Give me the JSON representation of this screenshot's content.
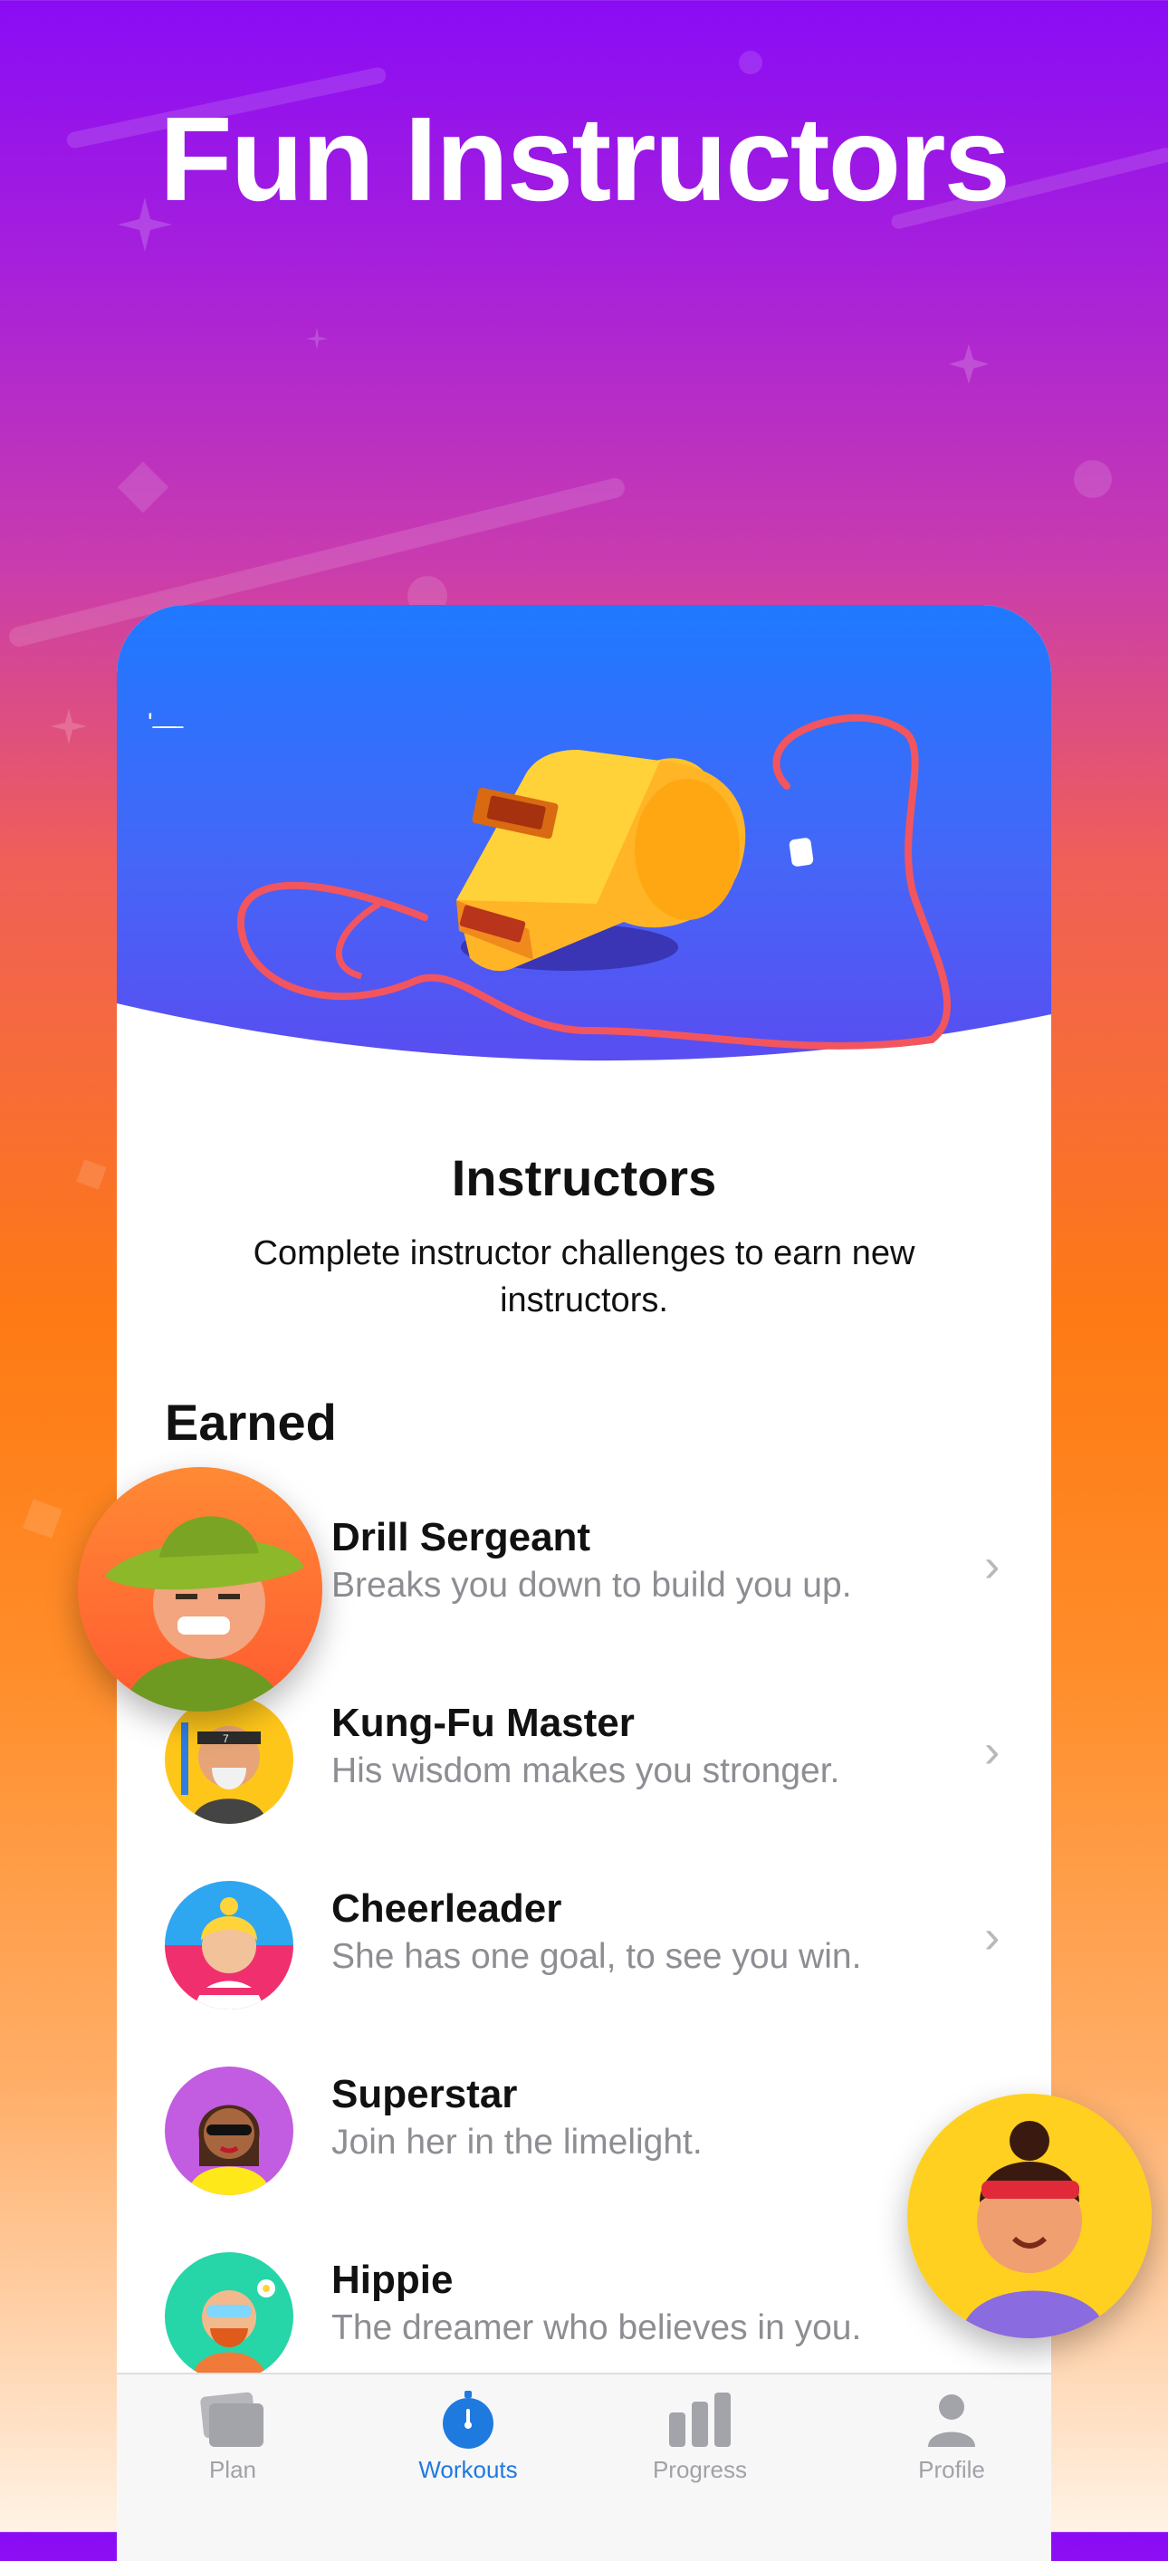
{
  "headline": "Fun Instructors",
  "screen": {
    "title": "Instructors",
    "subtitle": "Complete instructor challenges to earn new instructors.",
    "section_label": "Earned",
    "instructors": [
      {
        "name": "Drill Sergeant",
        "description": "Breaks you down to build you up.",
        "icon": "drill-sergeant-avatar",
        "chevron": true
      },
      {
        "name": "Kung-Fu Master",
        "description": "His wisdom makes you stronger.",
        "icon": "kung-fu-master-avatar",
        "chevron": true
      },
      {
        "name": "Cheerleader",
        "description": "She has one goal, to see you win.",
        "icon": "cheerleader-avatar",
        "chevron": true
      },
      {
        "name": "Superstar",
        "description": "Join her in the limelight.",
        "icon": "superstar-avatar",
        "chevron": false
      },
      {
        "name": "Hippie",
        "description": "The dreamer who believes in you.",
        "icon": "hippie-avatar",
        "chevron": false
      }
    ]
  },
  "tabbar": {
    "items": [
      {
        "label": "Plan",
        "icon": "plan-icon",
        "active": false
      },
      {
        "label": "Workouts",
        "icon": "stopwatch-icon",
        "active": true
      },
      {
        "label": "Progress",
        "icon": "bar-chart-icon",
        "active": false
      },
      {
        "label": "Profile",
        "icon": "person-icon",
        "active": false
      }
    ]
  },
  "colors": {
    "accent": "#1f7ae0",
    "hero_blue": "#1f79ff",
    "background_top": "#8a0cf5",
    "background_mid": "#fe7a14"
  }
}
